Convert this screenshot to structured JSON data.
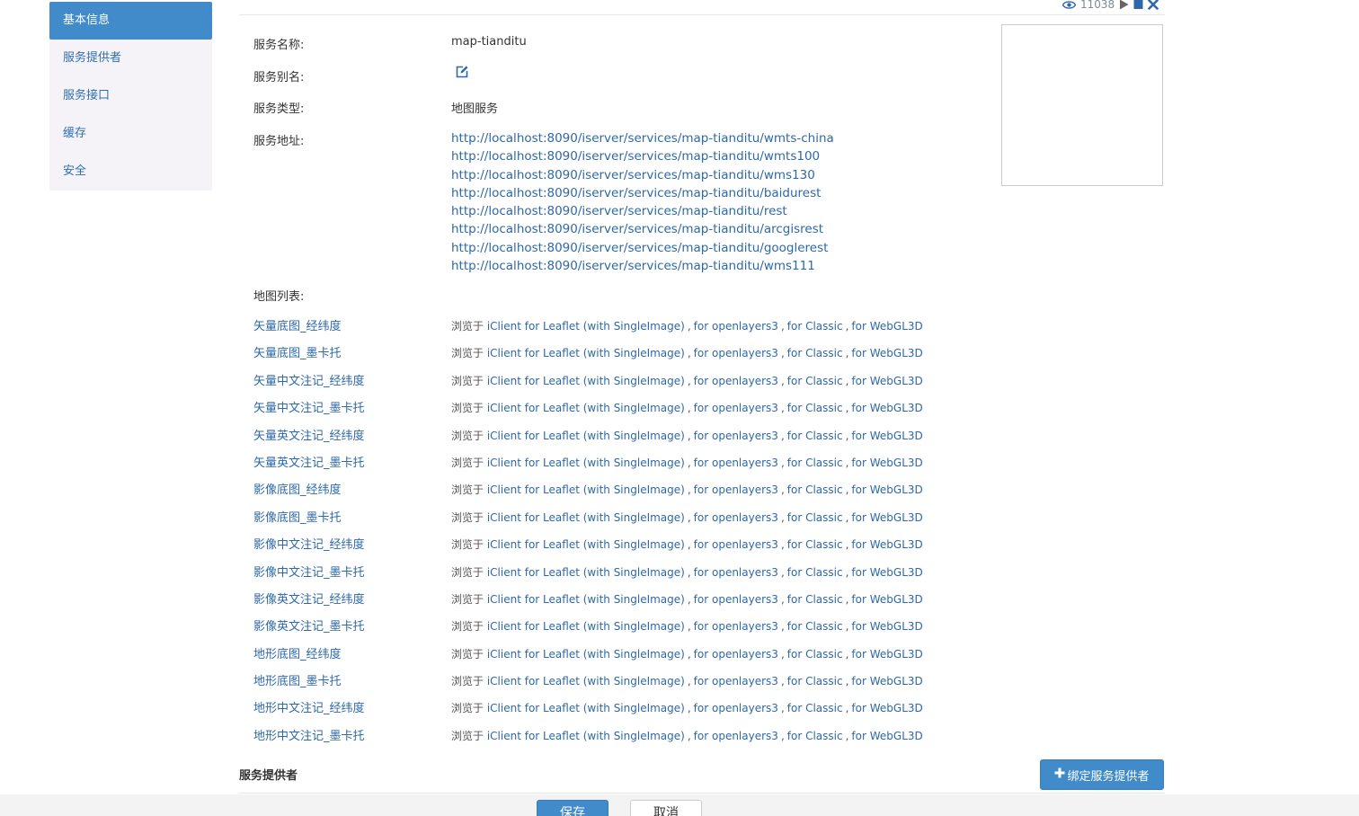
{
  "colors": {
    "accent": "#428bca",
    "link": "#2e68a8",
    "sidebar_bg": "#f5f3f8",
    "footer_bg": "#f3f3f3"
  },
  "sidebar": {
    "items": [
      {
        "label": "基本信息",
        "active": true
      },
      {
        "label": "服务提供者",
        "active": false
      },
      {
        "label": "服务接口",
        "active": false
      },
      {
        "label": "缓存",
        "active": false
      },
      {
        "label": "安全",
        "active": false
      }
    ]
  },
  "status": {
    "view_count": "11038",
    "icons": [
      "eye-icon",
      "play-icon",
      "stop-icon",
      "close-icon"
    ]
  },
  "info": {
    "name_label": "服务名称:",
    "name_value": "map-tianditu",
    "alias_label": "服务别名:",
    "alias_icon": "edit-icon",
    "type_label": "服务类型:",
    "type_value": "地图服务",
    "address_label": "服务地址:",
    "addresses": [
      "http://localhost:8090/iserver/services/map-tianditu/wmts-china",
      "http://localhost:8090/iserver/services/map-tianditu/wmts100",
      "http://localhost:8090/iserver/services/map-tianditu/wms130",
      "http://localhost:8090/iserver/services/map-tianditu/baidurest",
      "http://localhost:8090/iserver/services/map-tianditu/rest",
      "http://localhost:8090/iserver/services/map-tianditu/arcgisrest",
      "http://localhost:8090/iserver/services/map-tianditu/googlerest",
      "http://localhost:8090/iserver/services/map-tianditu/wms111"
    ],
    "map_list_label": "地图列表:"
  },
  "browse": {
    "prefix": "浏览于",
    "link1": "iClient for Leaflet",
    "link1_suffix": "(with SingleImage)",
    "link2": "for openlayers3",
    "link3": "for Classic",
    "link4": "for WebGL3D",
    "separator": ","
  },
  "maps": [
    "矢量底图_经纬度",
    "矢量底图_墨卡托",
    "矢量中文注记_经纬度",
    "矢量中文注记_墨卡托",
    "矢量英文注记_经纬度",
    "矢量英文注记_墨卡托",
    "影像底图_经纬度",
    "影像底图_墨卡托",
    "影像中文注记_经纬度",
    "影像中文注记_墨卡托",
    "影像英文注记_经纬度",
    "影像英文注记_墨卡托",
    "地形底图_经纬度",
    "地形底图_墨卡托",
    "地形中文注记_经纬度",
    "地形中文注记_墨卡托"
  ],
  "provider": {
    "title": "服务提供者",
    "bind_button": "绑定服务提供者"
  },
  "footer": {
    "save": "保存",
    "cancel": "取消"
  }
}
